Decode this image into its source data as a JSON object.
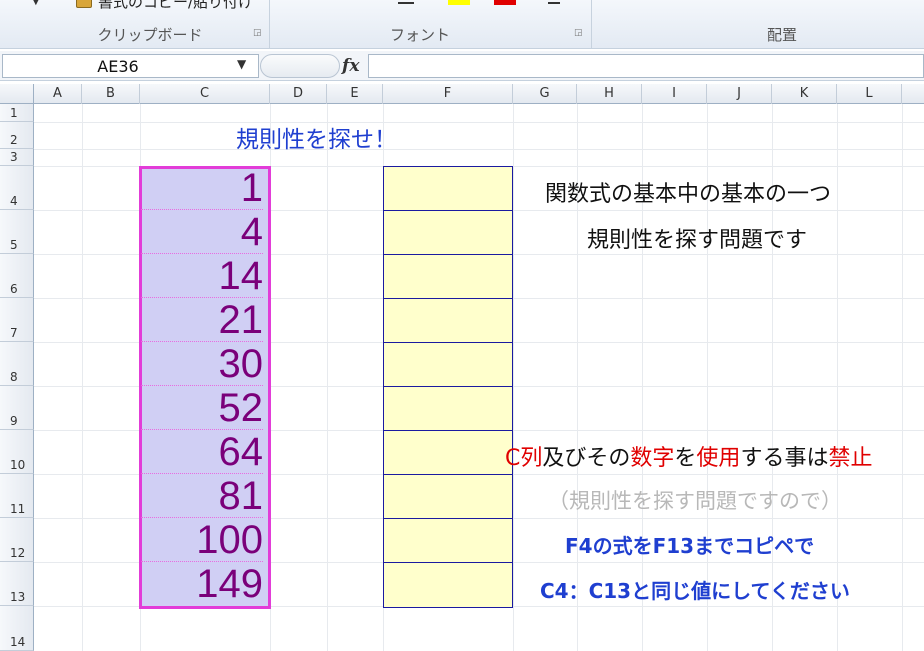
{
  "ribbon": {
    "clipboard_button": "書式のコピー/貼り付け",
    "groups": [
      "クリップボード",
      "フォント",
      "配置"
    ]
  },
  "formula_bar": {
    "name_box": "AE36",
    "fx_label": "fx",
    "formula": ""
  },
  "columns": [
    "A",
    "B",
    "C",
    "D",
    "E",
    "F",
    "G",
    "H",
    "I",
    "J",
    "K",
    "L"
  ],
  "rows": [
    "1",
    "2",
    "3",
    "4",
    "5",
    "6",
    "7",
    "8",
    "9",
    "10",
    "11",
    "12",
    "13",
    "14"
  ],
  "sheet": {
    "title": "規則性を探せ！",
    "c_values": [
      "1",
      "4",
      "14",
      "21",
      "30",
      "52",
      "64",
      "81",
      "100",
      "149"
    ],
    "desc_line1": "関数式の基本中の基本の一つ",
    "desc_line2": "規則性を探す問題です",
    "rule": {
      "part1": "C列",
      "part2": "及びその",
      "part3": "数字",
      "part4": "を",
      "part5": "使用",
      "part6": "する事は",
      "part7": "禁止"
    },
    "note": "（規則性を探す問題ですので）",
    "instruction1": "F4の式をF13までコピペで",
    "instruction2": "C4：C13と同じ値にしてください"
  },
  "colors": {
    "title_blue": "#1f3fd0",
    "c_border": "#e23cd8",
    "c_fill": "#d0cff4",
    "c_text": "#7a007a",
    "f_fill": "#ffffcc",
    "f_border": "#1a1aa0",
    "rule_red": "#e00000",
    "note_gray": "#b8b8b8"
  }
}
